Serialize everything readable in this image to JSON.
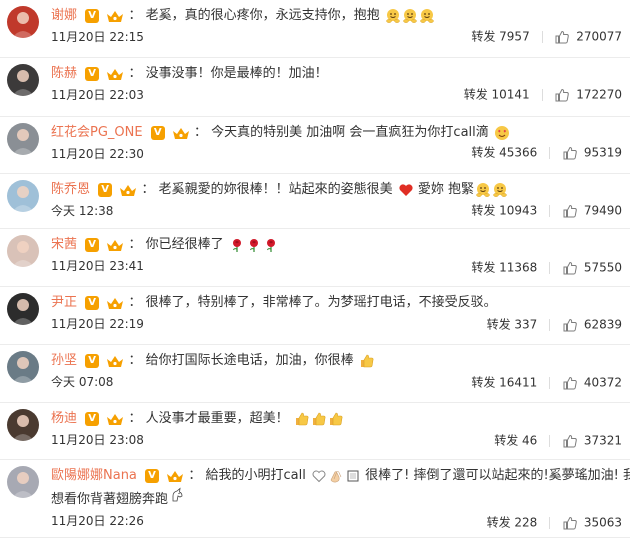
{
  "comments": [
    {
      "username": "谢娜",
      "text": "老奚，真的很心疼你，永远支持你，抱抱",
      "emoji": [
        "hug-emoji",
        "hug-emoji",
        "hug-emoji"
      ],
      "time": "11月20日 22:15",
      "repost_label": "转发 7957",
      "likes": "270077",
      "avatar_color": "#c0392b"
    },
    {
      "username": "陈赫",
      "text": "没事没事！你是最棒的！加油！",
      "emoji": [],
      "time": "11月20日 22:03",
      "repost_label": "转发 10141",
      "likes": "172270",
      "avatar_color": "#3c3a3a"
    },
    {
      "username": "红花会PG_ONE",
      "text": "今天真的特别美 加油啊 会一直疯狂为你打call滴",
      "emoji": [
        "heart-eyes-emoji"
      ],
      "time": "11月20日 22:30",
      "repost_label": "转发 45366",
      "likes": "95319",
      "avatar_color": "#8a8f95"
    },
    {
      "username": "陈乔恩",
      "text": "老奚親愛的妳很棒！！站起來的姿態很美",
      "text2": "愛妳 抱緊",
      "emoji": [
        "heart-emoji"
      ],
      "emoji2": [
        "hug-emoji",
        "hug-emoji"
      ],
      "time": "今天 12:38",
      "repost_label": "转发 10943",
      "likes": "79490",
      "avatar_color": "#9fc0d8"
    },
    {
      "username": "宋茜",
      "text": "你已经很棒了",
      "emoji": [
        "rose-emoji",
        "rose-emoji",
        "rose-emoji"
      ],
      "time": "11月20日 23:41",
      "repost_label": "转发 11368",
      "likes": "57550",
      "avatar_color": "#d9c2b8"
    },
    {
      "username": "尹正",
      "text": "很棒了，特别棒了，非常棒了。为梦瑶打电话，不接受反驳。",
      "emoji": [],
      "time": "11月20日 22:19",
      "repost_label": "转发 337",
      "likes": "62839",
      "avatar_color": "#2c2c2c"
    },
    {
      "username": "孙坚",
      "text": "给你打国际长途电话，加油，你很棒",
      "emoji": [
        "thumbs-up-emoji"
      ],
      "time": "今天 07:08",
      "repost_label": "转发 16411",
      "likes": "40372",
      "avatar_color": "#6a7b86"
    },
    {
      "username": "杨迪",
      "text": "人没事才最重要，超美！",
      "emoji": [
        "thumbs-up-emoji",
        "thumbs-up-emoji",
        "thumbs-up-emoji"
      ],
      "time": "11月20日 23:08",
      "repost_label": "转发 46",
      "likes": "37321",
      "avatar_color": "#4a3a30"
    },
    {
      "username": "歐陽娜娜Nana",
      "text": "給我的小明打call",
      "emoji": [
        "heart-outline-emoji",
        "clap-emoji",
        "box-emoji"
      ],
      "text2": "很棒了! 摔倒了還可以站起來的!奚夢瑤加油! 我還",
      "line3": "想看你背著翅膀奔跑",
      "emoji3": [
        "unicorn-emoji"
      ],
      "time": "11月20日 22:26",
      "repost_label": "转发 228",
      "likes": "35063",
      "avatar_color": "#a7a9b3"
    }
  ],
  "colors": {
    "username": "#eb7350",
    "vip_badge": "#f6a000",
    "crown": "#f6a000",
    "emoji_face": "#f7c846"
  }
}
